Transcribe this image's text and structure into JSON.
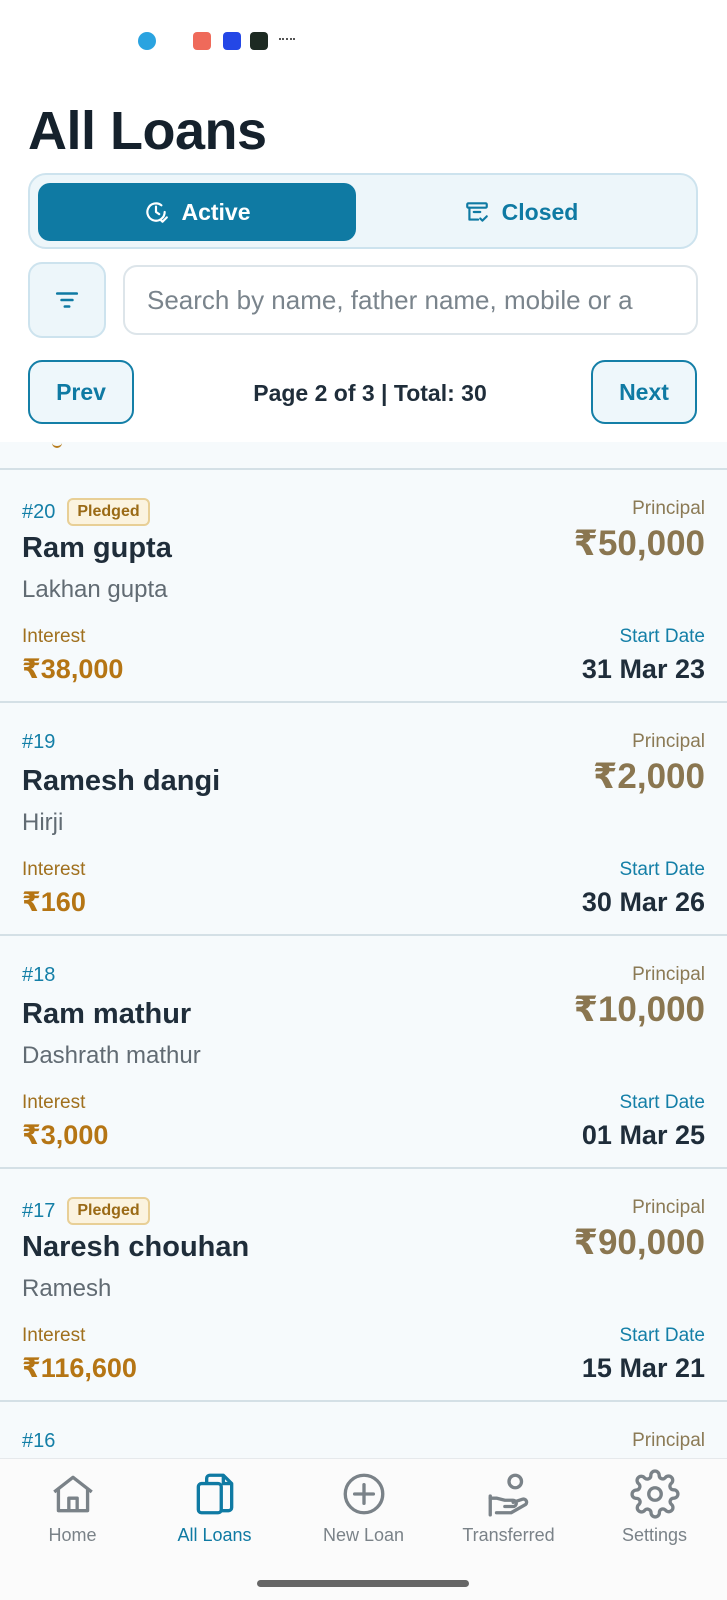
{
  "page_title": "All Loans",
  "tabs": {
    "active_label": "Active",
    "closed_label": "Closed"
  },
  "search": {
    "placeholder": "Search by name, father name, mobile or a"
  },
  "pagination": {
    "prev_label": "Prev",
    "next_label": "Next",
    "info": "Page 2 of 3 | Total: 30"
  },
  "loans": [
    {
      "id": "#20",
      "badge": "Pledged",
      "name": "Ram gupta",
      "father": "Lakhan gupta",
      "interest_label": "Interest",
      "interest": "₹38,000",
      "principal_label": "Principal",
      "principal": "₹50,000",
      "start_label": "Start Date",
      "start_date": "31 Mar 23"
    },
    {
      "id": "#19",
      "badge": "",
      "name": "Ramesh dangi",
      "father": "Hirji",
      "interest_label": "Interest",
      "interest": "₹160",
      "principal_label": "Principal",
      "principal": "₹2,000",
      "start_label": "Start Date",
      "start_date": "30 Mar 26"
    },
    {
      "id": "#18",
      "badge": "",
      "name": "Ram mathur",
      "father": "Dashrath mathur",
      "interest_label": "Interest",
      "interest": "₹3,000",
      "principal_label": "Principal",
      "principal": "₹10,000",
      "start_label": "Start Date",
      "start_date": "01 Mar 25"
    },
    {
      "id": "#17",
      "badge": "Pledged",
      "name": "Naresh chouhan",
      "father": "Ramesh",
      "interest_label": "Interest",
      "interest": "₹116,600",
      "principal_label": "Principal",
      "principal": "₹90,000",
      "start_label": "Start Date",
      "start_date": "15 Mar 21"
    },
    {
      "id": "#16",
      "badge": "",
      "name": "",
      "father": "",
      "interest_label": "",
      "interest": "",
      "principal_label": "Principal",
      "principal": "",
      "start_label": "",
      "start_date": ""
    }
  ],
  "nav": {
    "home": "Home",
    "all_loans": "All Loans",
    "new_loan": "New Loan",
    "transferred": "Transferred",
    "settings": "Settings"
  },
  "colors": {
    "accent": "#0f7aa3",
    "interest": "#b57514",
    "principal": "#8a7650",
    "badge_bg": "#fbf3df"
  },
  "status_icons": [
    "telegram-icon",
    "j-app-icon",
    "t-app-icon",
    "b-app-icon",
    "more-dots-icon"
  ]
}
